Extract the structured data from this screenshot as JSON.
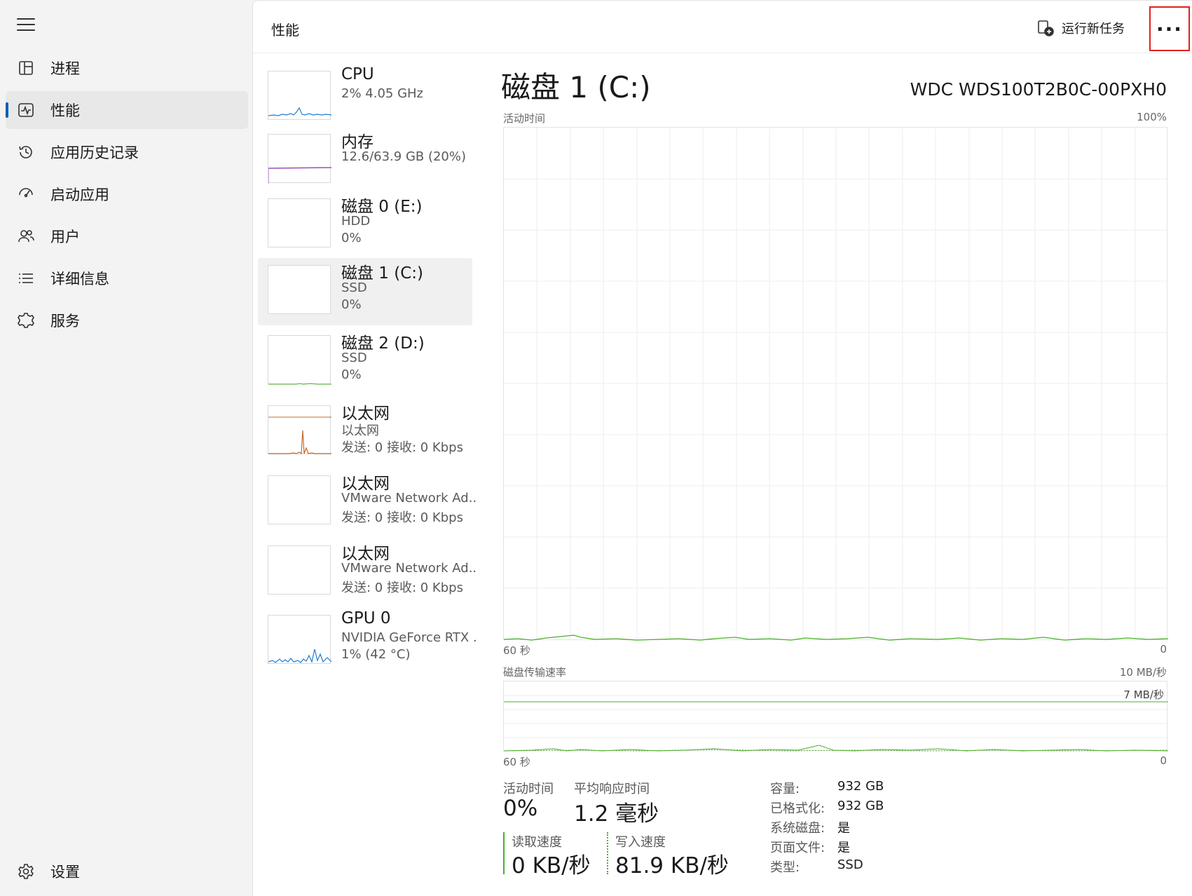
{
  "nav": {
    "items": [
      {
        "label": "进程",
        "icon": "processes-icon"
      },
      {
        "label": "性能",
        "icon": "performance-icon",
        "active": true
      },
      {
        "label": "应用历史记录",
        "icon": "history-icon"
      },
      {
        "label": "启动应用",
        "icon": "startup-icon"
      },
      {
        "label": "用户",
        "icon": "users-icon"
      },
      {
        "label": "详细信息",
        "icon": "details-icon"
      },
      {
        "label": "服务",
        "icon": "services-icon"
      }
    ],
    "settings": "设置"
  },
  "header": {
    "title": "性能",
    "run_task": "运行新任务",
    "more": "···"
  },
  "resources": [
    {
      "name": "CPU",
      "sub1": "2% 4.05 GHz",
      "sub2": ""
    },
    {
      "name": "内存",
      "sub1": "12.6/63.9 GB (20%)",
      "sub2": ""
    },
    {
      "name": "磁盘 0 (E:)",
      "sub1": "HDD",
      "sub2": "0%"
    },
    {
      "name": "磁盘 1 (C:)",
      "sub1": "SSD",
      "sub2": "0%",
      "selected": true
    },
    {
      "name": "磁盘 2 (D:)",
      "sub1": "SSD",
      "sub2": "0%"
    },
    {
      "name": "以太网",
      "sub1": "以太网",
      "sub2": "发送: 0 接收: 0 Kbps"
    },
    {
      "name": "以太网",
      "sub1": "VMware Network Ad..",
      "sub2": "发送: 0 接收: 0 Kbps"
    },
    {
      "name": "以太网",
      "sub1": "VMware Network Ad..",
      "sub2": "发送: 0 接收: 0 Kbps"
    },
    {
      "name": "GPU 0",
      "sub1": "NVIDIA GeForce RTX .",
      "sub2": "1% (42 °C)"
    }
  ],
  "detail": {
    "title": "磁盘 1 (C:)",
    "model": "WDC WDS100T2B0C-00PXH0",
    "active_chart": {
      "label": "活动时间",
      "max": "100%",
      "x_left": "60 秒",
      "x_right": "0"
    },
    "transfer_chart": {
      "label": "磁盘传输速率",
      "max": "10 MB/秒",
      "line_label": "7 MB/秒",
      "x_left": "60 秒",
      "x_right": "0"
    },
    "stats": {
      "active_label": "活动时间",
      "active_value": "0%",
      "resp_label": "平均响应时间",
      "resp_value": "1.2 毫秒",
      "read_label": "读取速度",
      "read_value": "0 KB/秒",
      "write_label": "写入速度",
      "write_value": "81.9 KB/秒"
    },
    "props": [
      {
        "key": "容量:",
        "val": "932 GB"
      },
      {
        "key": "已格式化:",
        "val": "932 GB"
      },
      {
        "key": "系统磁盘:",
        "val": "是"
      },
      {
        "key": "页面文件:",
        "val": "是"
      },
      {
        "key": "类型:",
        "val": "SSD"
      }
    ]
  },
  "colors": {
    "accent": "#005fb8",
    "disk_green": "#4caf2c",
    "cpu_blue": "#1f7fd1",
    "memory_purple": "#9b4fb8",
    "ethernet_orange": "#c8682a"
  }
}
